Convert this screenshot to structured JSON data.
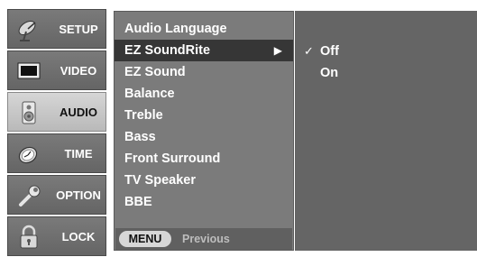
{
  "sidebar": {
    "items": [
      {
        "label": "SETUP",
        "icon": "satellite-dish-icon",
        "active": false
      },
      {
        "label": "VIDEO",
        "icon": "tv-screen-icon",
        "active": false
      },
      {
        "label": "AUDIO",
        "icon": "speaker-icon",
        "active": true
      },
      {
        "label": "TIME",
        "icon": "clock-icon",
        "active": false
      },
      {
        "label": "OPTION",
        "icon": "wrench-icon",
        "active": false
      },
      {
        "label": "LOCK",
        "icon": "padlock-icon",
        "active": false
      }
    ]
  },
  "menu": {
    "items": [
      {
        "label": "Audio Language"
      },
      {
        "label": "EZ SoundRite",
        "selected": true,
        "arrow": "▶"
      },
      {
        "label": "EZ Sound"
      },
      {
        "label": "Balance"
      },
      {
        "label": "Treble"
      },
      {
        "label": "Bass"
      },
      {
        "label": "Front Surround"
      },
      {
        "label": "TV Speaker"
      },
      {
        "label": "BBE"
      }
    ],
    "footer": {
      "button_label": "MENU",
      "hint": "Previous"
    }
  },
  "submenu": {
    "items": [
      {
        "label": "Off",
        "checked": true,
        "check": "✓"
      },
      {
        "label": "On",
        "checked": false
      }
    ]
  },
  "colors": {
    "panel": "#7b7b7b",
    "selected": "#363636",
    "submenu_panel": "#656565",
    "active_tab": "#c8c8c8"
  }
}
